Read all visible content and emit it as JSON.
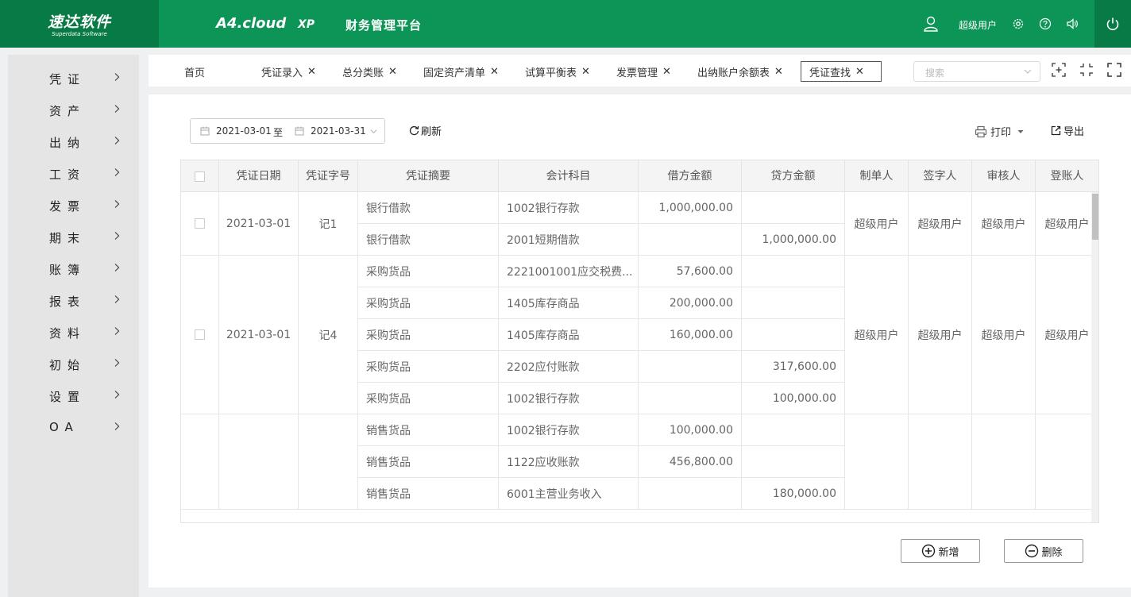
{
  "header": {
    "logo_main": "速达软件",
    "logo_sub": "Superdata Software",
    "product": "A4.cloud",
    "edition": "XP",
    "platform": "财务管理平台",
    "user": "超级用户"
  },
  "sidebar": {
    "items": [
      {
        "label": "凭证"
      },
      {
        "label": "资产"
      },
      {
        "label": "出纳"
      },
      {
        "label": "工资"
      },
      {
        "label": "发票"
      },
      {
        "label": "期末"
      },
      {
        "label": "账簿"
      },
      {
        "label": "报表"
      },
      {
        "label": "资料"
      },
      {
        "label": "初始"
      },
      {
        "label": "设置"
      },
      {
        "label": "OA"
      }
    ]
  },
  "tabs": {
    "items": [
      {
        "label": "首页"
      },
      {
        "label": "凭证录入"
      },
      {
        "label": "总分类账"
      },
      {
        "label": "固定资产清单"
      },
      {
        "label": "试算平衡表"
      },
      {
        "label": "发票管理"
      },
      {
        "label": "出纳账户余额表"
      },
      {
        "label": "凭证查找"
      }
    ],
    "close": "✕",
    "search_placeholder": "搜索"
  },
  "filters": {
    "date_from": "2021-03-01",
    "to": "至",
    "date_to": "2021-03-31",
    "refresh": "刷新",
    "print": "打印",
    "export": "导出"
  },
  "table": {
    "columns": [
      "凭证日期",
      "凭证字号",
      "凭证摘要",
      "会计科目",
      "借方金额",
      "贷方金额",
      "制单人",
      "签字人",
      "审核人",
      "登账人"
    ],
    "vouchers": [
      {
        "date": "2021-03-01",
        "number": "记1",
        "maker": "超级用户",
        "signer": "超级用户",
        "auditor": "超级用户",
        "poster": "超级用户",
        "lines": [
          {
            "summary": "银行借款",
            "account": "1002银行存款",
            "debit": "1,000,000.00",
            "credit": ""
          },
          {
            "summary": "银行借款",
            "account": "2001短期借款",
            "debit": "",
            "credit": "1,000,000.00"
          }
        ]
      },
      {
        "date": "2021-03-01",
        "number": "记4",
        "maker": "超级用户",
        "signer": "超级用户",
        "auditor": "超级用户",
        "poster": "超级用户",
        "lines": [
          {
            "summary": "采购货品",
            "account": "2221001001应交税费...",
            "debit": "57,600.00",
            "credit": ""
          },
          {
            "summary": "采购货品",
            "account": "1405库存商品",
            "debit": "200,000.00",
            "credit": ""
          },
          {
            "summary": "采购货品",
            "account": "1405库存商品",
            "debit": "160,000.00",
            "credit": ""
          },
          {
            "summary": "采购货品",
            "account": "2202应付账款",
            "debit": "",
            "credit": "317,600.00"
          },
          {
            "summary": "采购货品",
            "account": "1002银行存款",
            "debit": "",
            "credit": "100,000.00"
          }
        ]
      },
      {
        "date": "",
        "number": "",
        "maker": "",
        "signer": "",
        "auditor": "",
        "poster": "",
        "lines": [
          {
            "summary": "销售货品",
            "account": "1002银行存款",
            "debit": "100,000.00",
            "credit": ""
          },
          {
            "summary": "销售货品",
            "account": "1122应收账款",
            "debit": "456,800.00",
            "credit": ""
          },
          {
            "summary": "销售货品",
            "account": "6001主营业务收入",
            "debit": "",
            "credit": "180,000.00"
          }
        ]
      }
    ]
  },
  "actions": {
    "add": "新增",
    "delete": "删除"
  }
}
